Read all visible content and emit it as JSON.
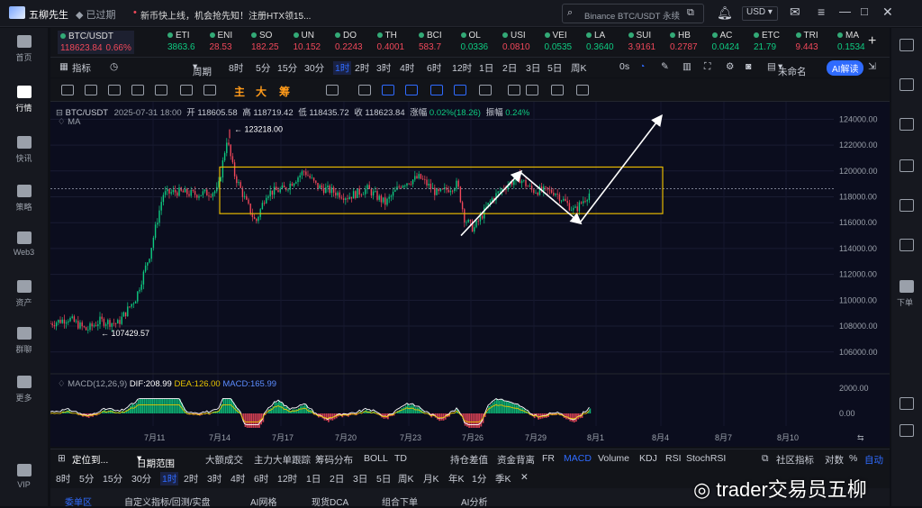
{
  "app": {
    "title": "五柳先生",
    "status": "已过期",
    "announce": "新币快上线，机会抢先知！注册HTX领15...",
    "search": "Binance BTC/USDT 永续",
    "currency": "USD"
  },
  "sidebar": [
    {
      "label": "首页",
      "active": false
    },
    {
      "label": "行情",
      "active": true
    },
    {
      "label": "快讯",
      "active": false
    },
    {
      "label": "策略",
      "active": false
    },
    {
      "label": "Web3",
      "active": false
    },
    {
      "label": "资产",
      "active": false
    },
    {
      "label": "群聊",
      "active": false
    },
    {
      "label": "更多",
      "active": false
    },
    {
      "label": "VIP",
      "active": false
    }
  ],
  "right_sidebar": {
    "download": "下单"
  },
  "tickers": [
    {
      "sym": "BTC/USDT",
      "price": "118623.84",
      "chg": "0.66%",
      "color": "#f0485a"
    },
    {
      "sym": "ETI",
      "price": "3863.6",
      "chg": "",
      "color": "#0ecb81"
    },
    {
      "sym": "ENI",
      "price": "28.53",
      "chg": "",
      "color": "#f0485a"
    },
    {
      "sym": "SO",
      "price": "182.25",
      "chg": "",
      "color": "#f0485a"
    },
    {
      "sym": "UN",
      "price": "10.152",
      "chg": "",
      "color": "#f0485a"
    },
    {
      "sym": "DO",
      "price": "0.2243",
      "chg": "",
      "color": "#f0485a"
    },
    {
      "sym": "TH",
      "price": "0.4001",
      "chg": "",
      "color": "#f0485a"
    },
    {
      "sym": "BCI",
      "price": "583.7",
      "chg": "",
      "color": "#f0485a"
    },
    {
      "sym": "OL",
      "price": "0.0336",
      "chg": "",
      "color": "#0ecb81"
    },
    {
      "sym": "USI",
      "price": "0.0810",
      "chg": "",
      "color": "#f0485a"
    },
    {
      "sym": "VEI",
      "price": "0.0535",
      "chg": "",
      "color": "#0ecb81"
    },
    {
      "sym": "LA",
      "price": "0.3640",
      "chg": "",
      "color": "#0ecb81"
    },
    {
      "sym": "SUI",
      "price": "3.9161",
      "chg": "",
      "color": "#f0485a"
    },
    {
      "sym": "HB",
      "price": "0.2787",
      "chg": "",
      "color": "#f0485a"
    },
    {
      "sym": "AC",
      "price": "0.0424",
      "chg": "",
      "color": "#0ecb81"
    },
    {
      "sym": "ETC",
      "price": "21.79",
      "chg": "",
      "color": "#0ecb81"
    },
    {
      "sym": "TRI",
      "price": "9.443",
      "chg": "",
      "color": "#f0485a"
    },
    {
      "sym": "MA",
      "price": "0.1534",
      "chg": "",
      "color": "#0ecb81"
    }
  ],
  "toolbar": {
    "indicator": "指标",
    "period": "周期",
    "intervals": [
      "8时",
      "5分",
      "15分",
      "30分",
      "1时",
      "2时",
      "3时",
      "4时",
      "6时",
      "12时",
      "1日",
      "2日",
      "3日",
      "5日",
      "周K"
    ],
    "active_interval": "1时",
    "time_opt": "0s",
    "unnamed": "未命名",
    "ai": "AI解读"
  },
  "drawing_tools": {
    "labels": [
      "主",
      "大",
      "筹"
    ]
  },
  "chart_info": {
    "symbol": "BTC/USDT",
    "datetime": "2025-07-31 18:00",
    "open_lbl": "开",
    "open": "118605.58",
    "high_lbl": "高",
    "high": "118719.42",
    "low_lbl": "低",
    "low": "118435.72",
    "close_lbl": "收",
    "close": "118623.84",
    "chg_lbl": "涨幅",
    "chg": "0.02%(18.26)",
    "amp_lbl": "振幅",
    "amp": "0.24%",
    "ma": "MA"
  },
  "chart_data": {
    "type": "candlestick",
    "price_axis": [
      "124000.00",
      "122000.00",
      "120000.00",
      "118000.00",
      "116000.00",
      "114000.00",
      "112000.00",
      "110000.00",
      "108000.00",
      "106000.00"
    ],
    "ylim": [
      104800,
      125000
    ],
    "date_axis": [
      "7月11",
      "7月14",
      "7月17",
      "7月20",
      "7月23",
      "7月26",
      "7月29",
      "8月1",
      "8月4",
      "8月7",
      "8月10"
    ],
    "current_price": 118623.84,
    "high_label": "123218.00",
    "high_value": 123218,
    "low_label": "107429.57",
    "low_value": 107429.57,
    "macd": {
      "label": "MACD(12,26,9)",
      "dif_lbl": "DIF:",
      "dif": "208.99",
      "dea_lbl": "DEA:",
      "dea": "126.00",
      "macd_lbl": "MACD:",
      "macd": "165.99",
      "axis": [
        "2000.00",
        "0.00"
      ]
    }
  },
  "bottom_toolbar": {
    "locate": "定位到...",
    "date_range": "日期范围",
    "items": [
      "大额成交",
      "主力大单跟踪",
      "筹码分布",
      "BOLL",
      "TD",
      "持仓差值",
      "资金背离",
      "FR",
      "MACD",
      "Volume",
      "KDJ",
      "RSI",
      "StochRSI"
    ],
    "community": "社区指标",
    "log": "对数",
    "pct": "%",
    "auto": "自动"
  },
  "period_bar": [
    "8时",
    "5分",
    "15分",
    "30分",
    "1时",
    "2时",
    "3时",
    "4时",
    "6时",
    "12时",
    "1日",
    "2日",
    "3日",
    "5日",
    "周K",
    "月K",
    "年K",
    "1分",
    "季K"
  ],
  "bottom_tabs": [
    "委单区",
    "自定义指标/回测/实盘",
    "AI网格",
    "现货DCA",
    "组合下单",
    "AI分析"
  ],
  "watermark": "trader交易员五柳",
  "colors": {
    "up": "#0ecb81",
    "down": "#f0485a",
    "accent": "#2f6bff",
    "box": "#e6b800"
  }
}
